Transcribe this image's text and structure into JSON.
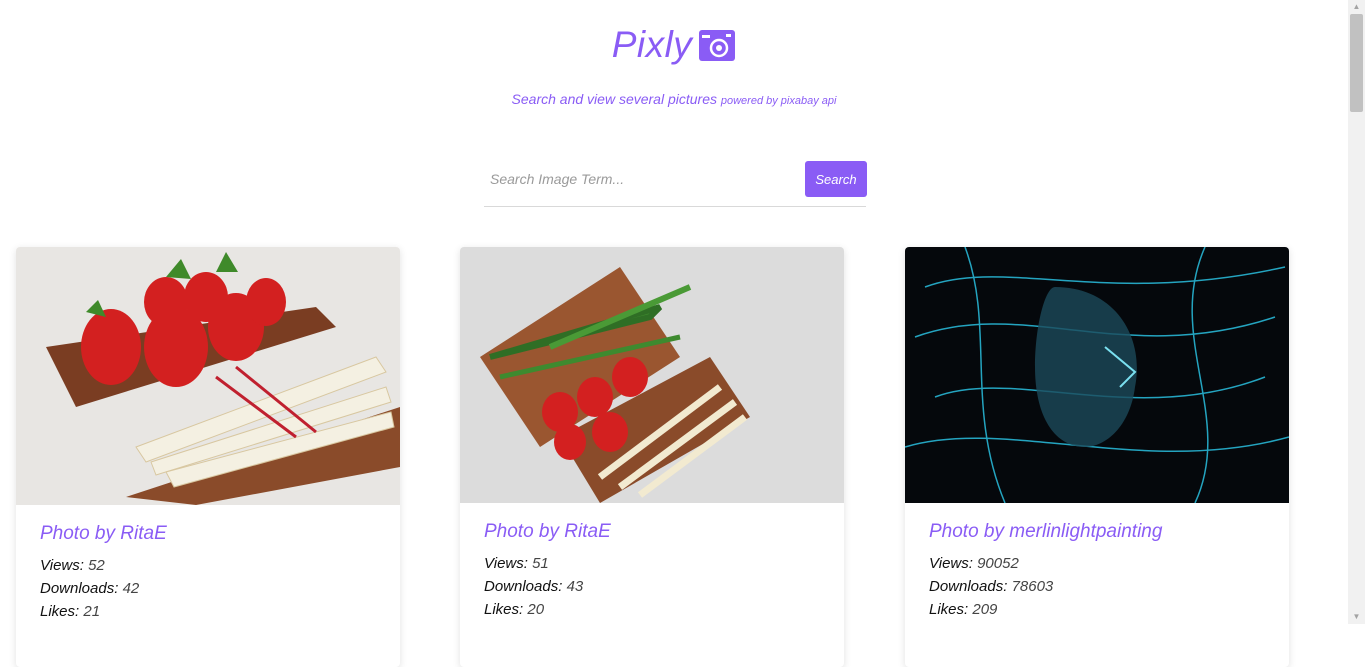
{
  "app": {
    "logo_text": "Pixly",
    "subtitle": "Search and view several pictures",
    "subtitle_small": "powered by pixabay api"
  },
  "search": {
    "placeholder": "Search Image Term...",
    "button_label": "Search"
  },
  "cards": [
    {
      "title": "Photo by RitaE",
      "views_label": "Views:",
      "views": "52",
      "downloads_label": "Downloads:",
      "downloads": "42",
      "likes_label": "Likes:",
      "likes": "21"
    },
    {
      "title": "Photo by RitaE",
      "views_label": "Views:",
      "views": "51",
      "downloads_label": "Downloads:",
      "downloads": "43",
      "likes_label": "Likes:",
      "likes": "20"
    },
    {
      "title": "Photo by merlinlightpainting",
      "views_label": "Views:",
      "views": "90052",
      "downloads_label": "Downloads:",
      "downloads": "78603",
      "likes_label": "Likes:",
      "likes": "209"
    }
  ],
  "colors": {
    "accent": "#8a5cf5"
  }
}
